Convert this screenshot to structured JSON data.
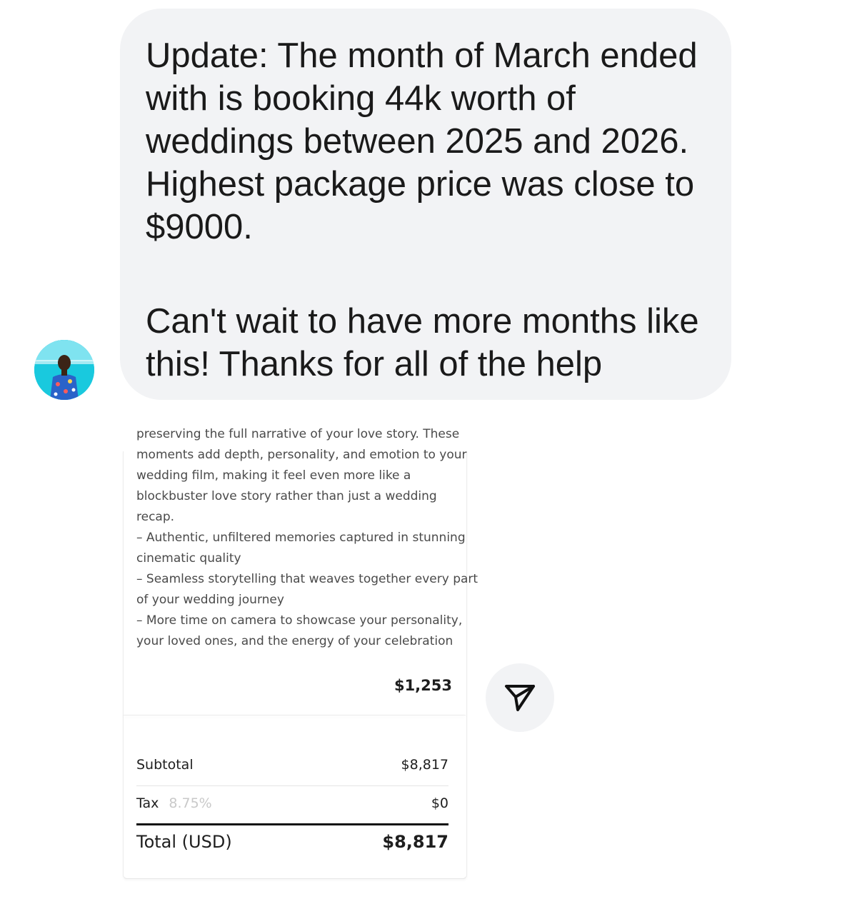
{
  "message": {
    "lines": [
      "Update: The month of March ended",
      "with is booking 44k worth of",
      "weddings between 2025 and 2026.",
      "Highest package price was close to",
      "$9000."
    ],
    "lines_2": [
      "Can't wait to have more months like",
      "this! Thanks for all of the help"
    ]
  },
  "avatar": {
    "icon": "user-avatar"
  },
  "attachment": {
    "description_lines": [
      "preserving the full narrative of your love story. These",
      "moments add depth, personality, and emotion to your",
      "wedding film, making it feel even more like a",
      "blockbuster love story rather than just a wedding",
      "recap.",
      "– Authentic, unfiltered memories captured in stunning",
      "cinematic quality",
      "– Seamless storytelling that weaves together every part",
      "of your wedding journey",
      "– More time on camera to showcase your personality,",
      "your loved ones, and the energy of your celebration"
    ],
    "item_price": "$1,253",
    "subtotal_label": "Subtotal",
    "subtotal_value": "$8,817",
    "tax_label": "Tax",
    "tax_rate": "8.75%",
    "tax_value": "$0",
    "total_label": "Total (USD)",
    "total_value": "$8,817"
  },
  "share": {
    "icon": "send-icon"
  },
  "colors": {
    "bubble_bg": "#f2f3f5",
    "text": "#1a1a1a",
    "muted": "#4a4a4a",
    "tax_rate": "#c9c9c9"
  }
}
